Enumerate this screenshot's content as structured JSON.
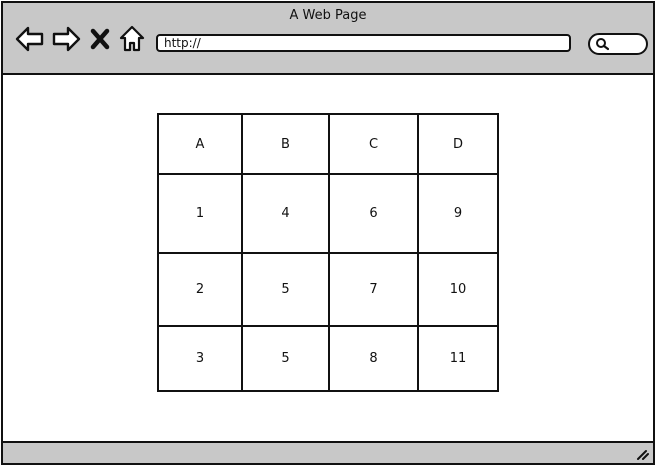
{
  "window": {
    "title": "A Web Page"
  },
  "toolbar": {
    "back_icon": "back-arrow-icon",
    "forward_icon": "forward-arrow-icon",
    "stop_icon": "close-x-icon",
    "home_icon": "home-icon",
    "address_value": "http://",
    "search_icon": "search-icon"
  },
  "table": {
    "headers": [
      "A",
      "B",
      "C",
      "D"
    ],
    "rows": [
      [
        "1",
        "4",
        "6",
        "9"
      ],
      [
        "2",
        "5",
        "7",
        "10"
      ],
      [
        "3",
        "5",
        "8",
        "11"
      ]
    ]
  },
  "statusbar": {
    "resize_icon": "resize-handle-icon"
  }
}
